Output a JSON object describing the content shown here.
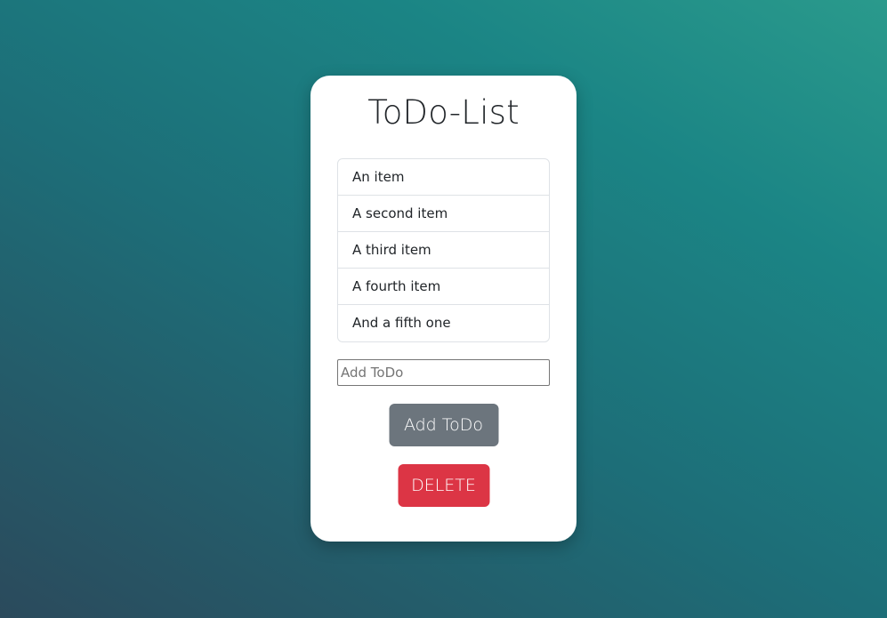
{
  "app": {
    "title": "ToDo-List"
  },
  "todos": [
    {
      "label": "An item"
    },
    {
      "label": "A second item"
    },
    {
      "label": "A third item"
    },
    {
      "label": "A fourth item"
    },
    {
      "label": "And a fifth one"
    }
  ],
  "input": {
    "value": "",
    "placeholder": "Add ToDo"
  },
  "buttons": {
    "add_label": "Add ToDo",
    "delete_label": "DELETE"
  },
  "colors": {
    "add_button": "#6c757d",
    "delete_button": "#dc3545",
    "card_background": "#ffffff"
  }
}
